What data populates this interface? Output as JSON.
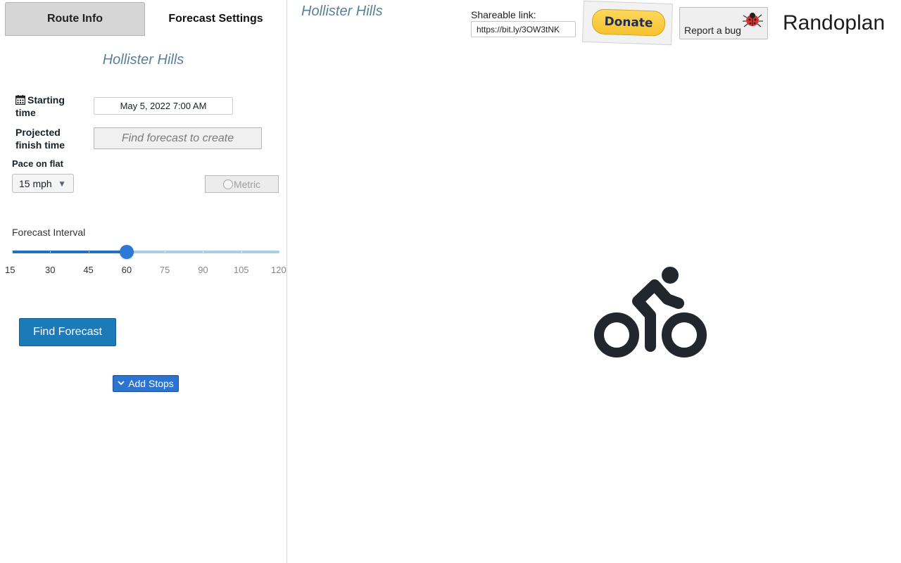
{
  "tabs": [
    {
      "label": "Route Info",
      "active": false
    },
    {
      "label": "Forecast Settings",
      "active": true
    }
  ],
  "route_title": "Hollister Hills",
  "starting_time": {
    "label": "Starting time",
    "value": "May 5, 2022 7:00 AM",
    "icon": "calendar-icon"
  },
  "finish_time": {
    "label": "Projected finish time",
    "placeholder": "Find forecast to create"
  },
  "pace": {
    "label": "Pace on flat",
    "selected": "15 mph"
  },
  "metric": {
    "label": "Metric",
    "checked": false
  },
  "forecast_interval": {
    "label": "Forecast Interval",
    "min": 15,
    "max": 120,
    "value": 60,
    "marks": [
      "15",
      "30",
      "45",
      "60",
      "75",
      "90",
      "105",
      "120"
    ]
  },
  "find_forecast": {
    "label": "Find Forecast"
  },
  "add_stops": {
    "label": "Add Stops"
  },
  "header": {
    "map_title": "Hollister Hills",
    "share_label": "Shareable link:",
    "share_url": "https://bit.ly/3OW3tNK",
    "donate_label": "Donate",
    "bug_label": "Report a bug",
    "brand": "Randoplan"
  },
  "colors": {
    "accent": "#2c7ad4",
    "primary_button": "#1d7ab8",
    "title_blue": "#5a7f96",
    "slider_rail": "#a9cde6",
    "donate_yellow": "#f6c330"
  },
  "icons": [
    "calendar-icon",
    "caret-down-icon",
    "chevron-down-icon",
    "bug-icon",
    "cyclist-icon"
  ]
}
